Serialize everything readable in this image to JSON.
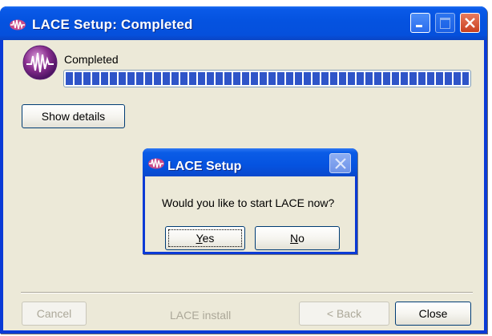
{
  "window": {
    "title": "LACE Setup: Completed",
    "title_buttons": [
      "minimize-button",
      "maximize-button",
      "close-button"
    ]
  },
  "status": {
    "label": "Completed",
    "progress_percent": 100
  },
  "buttons": {
    "show_details": "Show details",
    "cancel": "Cancel",
    "back": "< Back",
    "close": "Close"
  },
  "footer": {
    "label": "LACE install"
  },
  "dialog": {
    "title": "LACE Setup",
    "message": "Would you like to start LACE now?",
    "yes_mnemonic": "Y",
    "yes_rest": "es",
    "no_mnemonic": "N",
    "no_rest": "o"
  },
  "colors": {
    "titlebar_blue": "#0553e0",
    "face": "#ece9d8",
    "progress_block": "#2f55c8",
    "disabled_text": "#aca899",
    "close_red": "#c9401f"
  },
  "icons": {
    "app": "lace-logo-icon",
    "minimize": "minimize-icon",
    "maximize": "maximize-icon",
    "close": "close-icon"
  }
}
